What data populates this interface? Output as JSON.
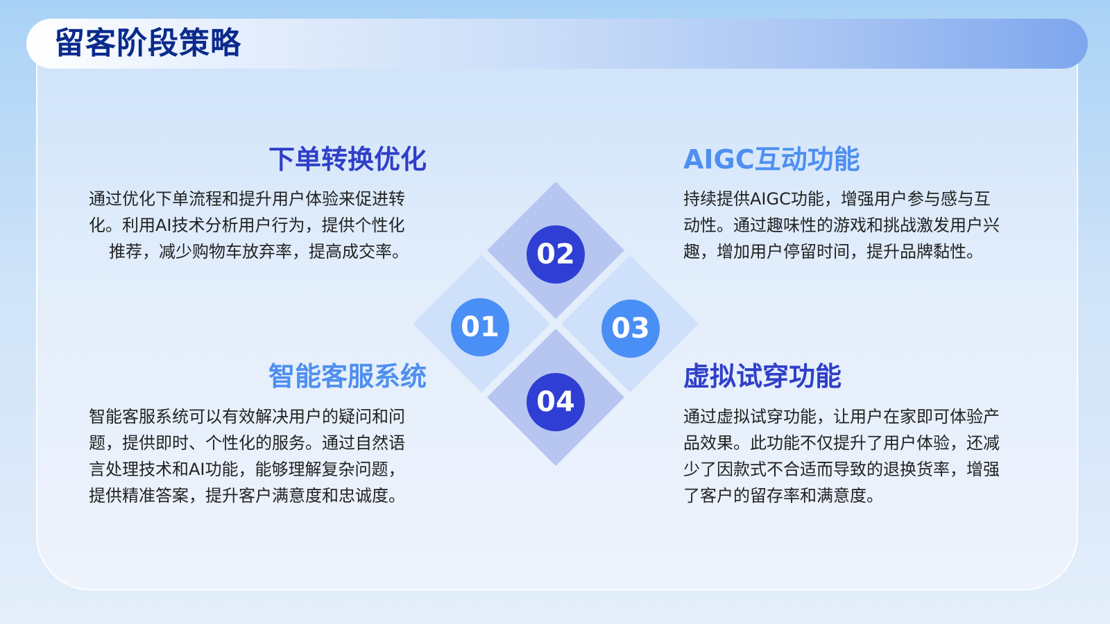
{
  "page": {
    "title": "留客阶段策略"
  },
  "sections": [
    {
      "number": "01",
      "title": "下单转换优化",
      "lines": [
        "通过优化下单流程和提升用户体验来促进转",
        "化。利用AI技术分析用户行为，提供个性化",
        "推荐，减少购物车放弃率，提高成交率。"
      ]
    },
    {
      "number": "02",
      "title": "AIGC互动功能",
      "lines": [
        "持续提供AIGC功能，增强用户参与感与互",
        "动性。通过趣味性的游戏和挑战激发用户兴",
        "趣，增加用户停留时间，提升品牌黏性。"
      ]
    },
    {
      "number": "03",
      "title": "智能客服系统",
      "lines": [
        "智能客服系统可以有效解决用户的疑问和问",
        "题，提供即时、个性化的服务。通过自然语",
        "言处理技术和AI功能，能够理解复杂问题，",
        "提供精准答案，提升客户满意度和忠诚度。"
      ]
    },
    {
      "number": "04",
      "title": "虚拟试穿功能",
      "lines": [
        "通过虚拟试穿功能，让用户在家即可体验产",
        "品效果。此功能不仅提升了用户体验，还减",
        "少了因款式不合适而导致的退换货率，增强",
        "了客户的留存率和满意度。"
      ]
    }
  ],
  "colors": {
    "title": "#0a2a8c",
    "accent_dark": "#2f3fd3",
    "accent_light": "#4a8ff6",
    "diamond_blue_grey": "#b6c6f1",
    "diamond_light": "#cfe0fb"
  }
}
